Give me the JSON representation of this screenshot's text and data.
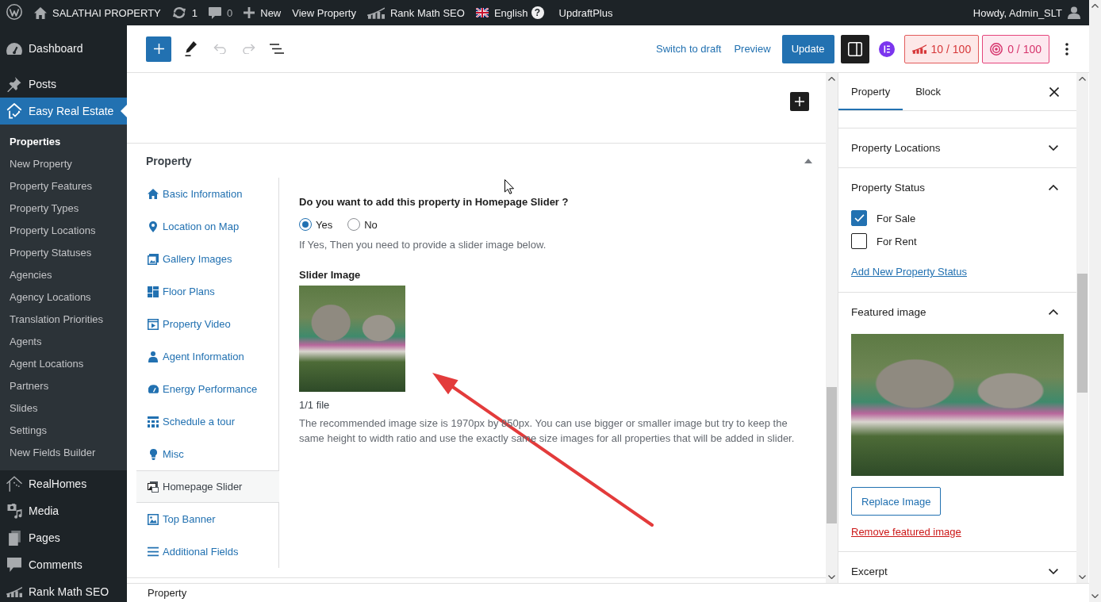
{
  "admin_bar": {
    "site_name": "SALATHAI PROPERTY",
    "updates": "1",
    "comments": "0",
    "new": "New",
    "view": "View Property",
    "seo": "Rank Math SEO",
    "language": "English",
    "help": "?",
    "backup": "UpdraftPlus",
    "greeting": "Howdy, Admin_SLT"
  },
  "admin_menu": {
    "items": [
      {
        "label": "Dashboard",
        "selected": false
      },
      {
        "label": "Posts",
        "selected": false
      },
      {
        "label": "Easy Real Estate",
        "selected": true,
        "children": [
          {
            "label": "Properties",
            "selected": true
          },
          {
            "label": "New Property",
            "selected": false
          },
          {
            "label": "Property Features",
            "selected": false
          },
          {
            "label": "Property Types",
            "selected": false
          },
          {
            "label": "Property Locations",
            "selected": false
          },
          {
            "label": "Property Statuses",
            "selected": false
          },
          {
            "label": "Agencies",
            "selected": false
          },
          {
            "label": "Agency Locations",
            "selected": false
          },
          {
            "label": "Translation Priorities",
            "selected": false
          },
          {
            "label": "Agents",
            "selected": false
          },
          {
            "label": "Agent Locations",
            "selected": false
          },
          {
            "label": "Partners",
            "selected": false
          },
          {
            "label": "Slides",
            "selected": false
          },
          {
            "label": "Settings",
            "selected": false
          },
          {
            "label": "New Fields Builder",
            "selected": false
          }
        ]
      },
      {
        "label": "RealHomes",
        "selected": false
      },
      {
        "label": "Media",
        "selected": false
      },
      {
        "label": "Pages",
        "selected": false
      },
      {
        "label": "Comments",
        "selected": false
      },
      {
        "label": "Rank Math SEO",
        "selected": false
      }
    ]
  },
  "toolbar": {
    "undo": {
      "disabled": true
    },
    "redo": {
      "disabled": true
    },
    "switch_to_draft": "Switch to draft",
    "preview": "Preview",
    "update": "Update",
    "settings_toggle": {
      "pressed": true
    },
    "seo_score": "10 / 100",
    "readability_score": "0 / 100"
  },
  "meta_box": {
    "title": "Property",
    "expanded": true,
    "tabs": [
      {
        "label": "Basic Information",
        "selected": false
      },
      {
        "label": "Location on Map",
        "selected": false
      },
      {
        "label": "Gallery Images",
        "selected": false
      },
      {
        "label": "Floor Plans",
        "selected": false
      },
      {
        "label": "Property Video",
        "selected": false
      },
      {
        "label": "Agent Information",
        "selected": false
      },
      {
        "label": "Energy Performance",
        "selected": false
      },
      {
        "label": "Schedule a tour",
        "selected": false
      },
      {
        "label": "Misc",
        "selected": false
      },
      {
        "label": "Homepage Slider",
        "selected": true
      },
      {
        "label": "Top Banner",
        "selected": false
      },
      {
        "label": "Additional Fields",
        "selected": false
      }
    ],
    "panel": {
      "question": "Do you want to add this property in Homepage Slider ?",
      "options": [
        {
          "label": "Yes",
          "selected": true
        },
        {
          "label": "No",
          "selected": false
        }
      ],
      "hint": "If Yes, Then you need to provide a slider image below.",
      "image_label": "Slider Image",
      "file_count": "1/1 file",
      "description": "The recommended image size is 1970px by 850px. You can use bigger or smaller image but try to keep the same height to width ratio and use the exactly same size images for all properties that will be added in slider."
    }
  },
  "sidebar": {
    "tabs": [
      {
        "label": "Property",
        "selected": true
      },
      {
        "label": "Block",
        "selected": false
      }
    ],
    "panels": [
      {
        "kind": "plain",
        "title": "Property Locations",
        "expanded": false
      },
      {
        "kind": "terms",
        "title": "Property Status",
        "expanded": true,
        "checkboxes": [
          {
            "label": "For Sale",
            "checked": true
          },
          {
            "label": "For Rent",
            "checked": false
          }
        ],
        "link": "Add New Property Status"
      },
      {
        "kind": "image",
        "title": "Featured image",
        "expanded": true,
        "button": "Replace Image",
        "remove_link": "Remove featured image"
      },
      {
        "kind": "plain",
        "title": "Excerpt",
        "expanded": false
      }
    ]
  },
  "footer": {
    "breadcrumb": "Property"
  }
}
